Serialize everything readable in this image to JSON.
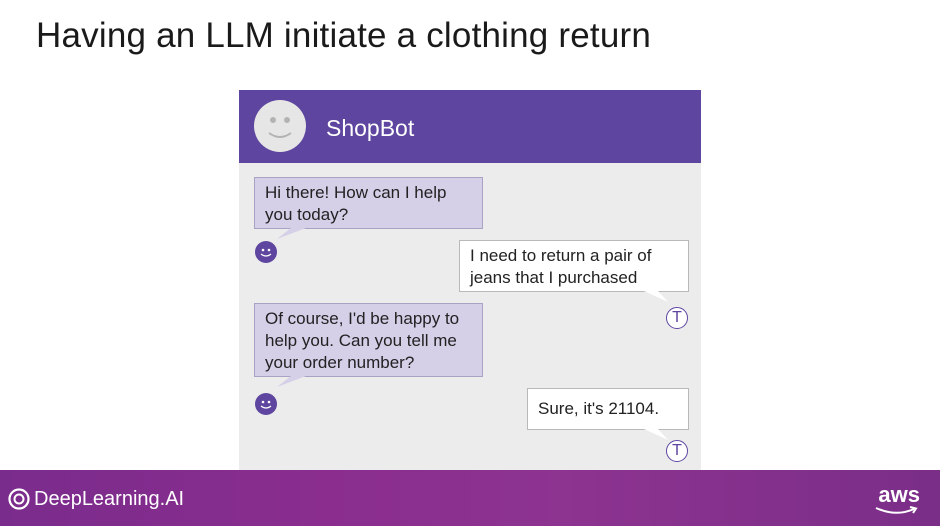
{
  "slide": {
    "title": "Having an LLM initiate a clothing return"
  },
  "chat": {
    "bot_name": "ShopBot",
    "messages": [
      {
        "sender": "bot",
        "text": "Hi there! How can I help you today?"
      },
      {
        "sender": "user",
        "text": "I need to return a pair of jeans that I purchased"
      },
      {
        "sender": "bot",
        "text": "Of course, I'd be happy to help you. Can you tell me your order number?"
      },
      {
        "sender": "user",
        "text": "Sure, it's 21104."
      }
    ],
    "user_initial": "T",
    "colors": {
      "header": "#5e45a0",
      "bot_bubble": "#d5cfe8",
      "background": "#ececec"
    }
  },
  "footer": {
    "brand": "DeepLearning.AI",
    "partner": "aws",
    "colors": {
      "gradient_start": "#7a2c8c",
      "gradient_end": "#7a2e88"
    }
  }
}
